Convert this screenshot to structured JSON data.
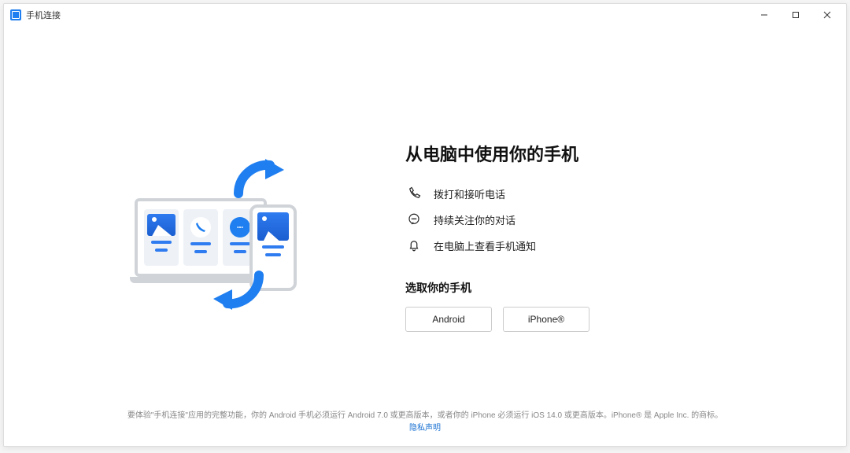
{
  "title": "手机连接",
  "headline": "从电脑中使用你的手机",
  "features": [
    {
      "label": "拨打和接听电话"
    },
    {
      "label": "持续关注你的对话"
    },
    {
      "label": "在电脑上查看手机通知"
    }
  ],
  "subhead": "选取你的手机",
  "buttons": {
    "android": "Android",
    "iphone": "iPhone®"
  },
  "footer": {
    "line": "要体验\"手机连接\"应用的完整功能，你的 Android 手机必须运行 Android 7.0 或更高版本，或者你的 iPhone 必须运行 iOS 14.0 或更高版本。iPhone® 是 Apple Inc. 的商标。",
    "privacy": "隐私声明"
  }
}
